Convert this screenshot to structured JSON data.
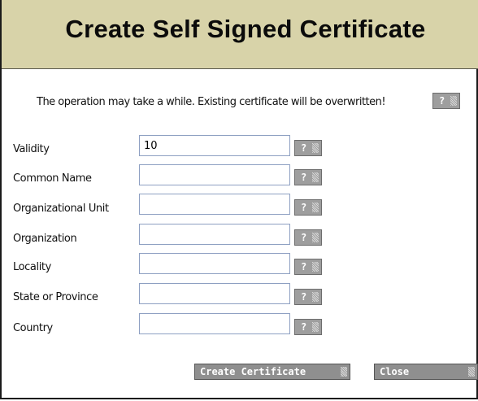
{
  "dialog": {
    "title": "Create Self Signed Certificate",
    "notice": "The operation may take a while. Existing certificate will be overwritten!",
    "help_label": "?"
  },
  "fields": [
    {
      "label": "Validity",
      "value": "10"
    },
    {
      "label": "Common Name",
      "value": ""
    },
    {
      "label": "Organizational Unit",
      "value": ""
    },
    {
      "label": "Organization",
      "value": ""
    },
    {
      "label": "Locality",
      "value": ""
    },
    {
      "label": "State or Province",
      "value": ""
    },
    {
      "label": "Country",
      "value": ""
    }
  ],
  "buttons": {
    "create": "Create Certificate",
    "close": "Close"
  },
  "colors": {
    "header_bg": "#d8d3a9",
    "button_bg": "#8f8f8f",
    "field_border": "#8ea0c2"
  },
  "icons": {
    "help": "help-icon",
    "grip": "grip-icon"
  }
}
